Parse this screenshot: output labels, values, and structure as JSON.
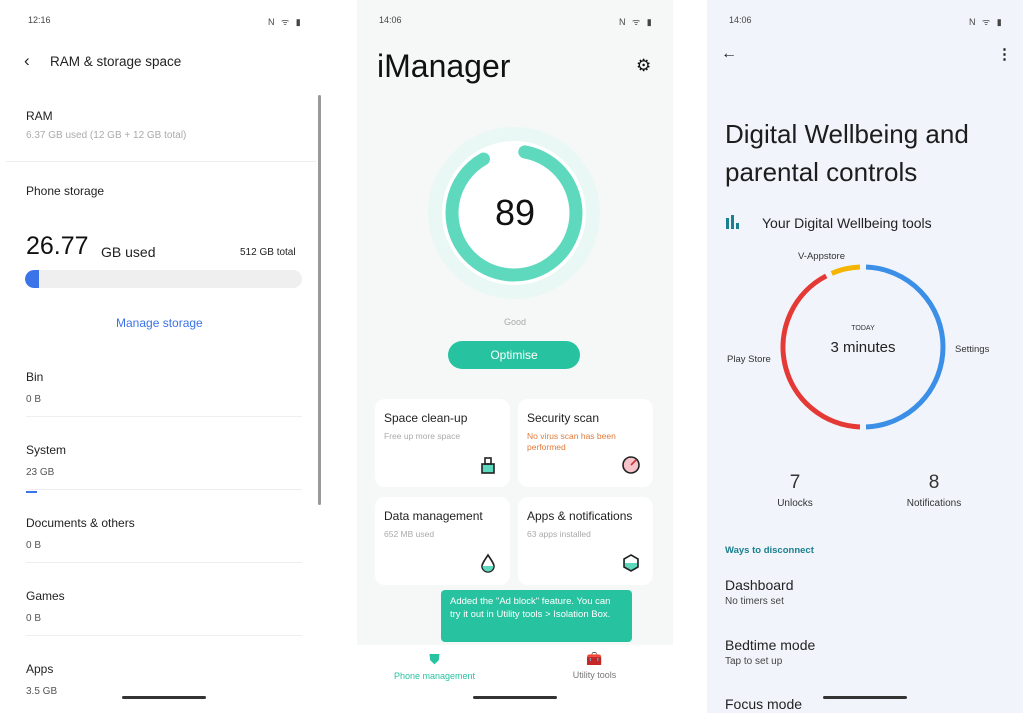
{
  "ram_storage": {
    "status": {
      "time": "12:16",
      "icons": "N ᯤ ▮"
    },
    "title": "RAM & storage space",
    "ram": {
      "label": "RAM",
      "detail": "6.37 GB used (12 GB + 12 GB total)"
    },
    "phone_storage": {
      "label": "Phone storage",
      "used_value": "26.77",
      "used_unit": "GB used",
      "total": "512 GB total",
      "used_fraction": 0.052
    },
    "manage_link": "Manage storage",
    "items": [
      {
        "label": "Bin",
        "value": "0 B"
      },
      {
        "label": "System",
        "value": "23 GB"
      },
      {
        "label": "Documents & others",
        "value": "0 B"
      },
      {
        "label": "Games",
        "value": "0 B"
      },
      {
        "label": "Apps",
        "value": "3.5 GB"
      }
    ],
    "accent": "#3b73e8"
  },
  "imanager": {
    "status": {
      "time": "14:06",
      "icons": "N ᯤ ▮"
    },
    "title": "iManager",
    "score": "89",
    "score_fraction": 0.89,
    "score_label": "Good",
    "optimise": "Optimise",
    "cards": [
      {
        "title": "Space clean-up",
        "sub": "Free up more space",
        "icon": "brush-icon"
      },
      {
        "title": "Security scan",
        "sub": "No virus scan has been performed",
        "icon": "gauge-icon"
      },
      {
        "title": "Data management",
        "sub": "652 MB used",
        "icon": "drop-icon"
      },
      {
        "title": "Apps & notifications",
        "sub": "63 apps installed",
        "icon": "hexagon-icon"
      }
    ],
    "tooltip": "Added the \"Ad block\" feature. You can try it out in Utility tools > Isolation Box.",
    "nav": [
      {
        "label": "Phone management",
        "icon": "shield-icon"
      },
      {
        "label": "Utility tools",
        "icon": "toolbox-icon"
      }
    ],
    "accent": "#27c3a0"
  },
  "wellbeing": {
    "status": {
      "time": "14:06",
      "icons": "N ᯤ ▮"
    },
    "title": "Digital Wellbeing and parental controls",
    "tools_header": "Your Digital Wellbeing tools",
    "chart": {
      "center_top": "TODAY",
      "center_value": "3 minutes",
      "segments": [
        {
          "label": "Settings",
          "share": 0.5,
          "color": "#3b8fe6"
        },
        {
          "label": "Play Store",
          "share": 0.43,
          "color": "#e53935"
        },
        {
          "label": "V-Appstore",
          "share": 0.07,
          "color": "#f4b400"
        }
      ]
    },
    "stats": [
      {
        "value": "7",
        "label": "Unlocks"
      },
      {
        "value": "8",
        "label": "Notifications"
      }
    ],
    "section": "Ways to disconnect",
    "items": [
      {
        "title": "Dashboard",
        "sub": "No timers set"
      },
      {
        "title": "Bedtime mode",
        "sub": "Tap to set up"
      },
      {
        "title": "Focus mode",
        "sub": ""
      }
    ]
  }
}
